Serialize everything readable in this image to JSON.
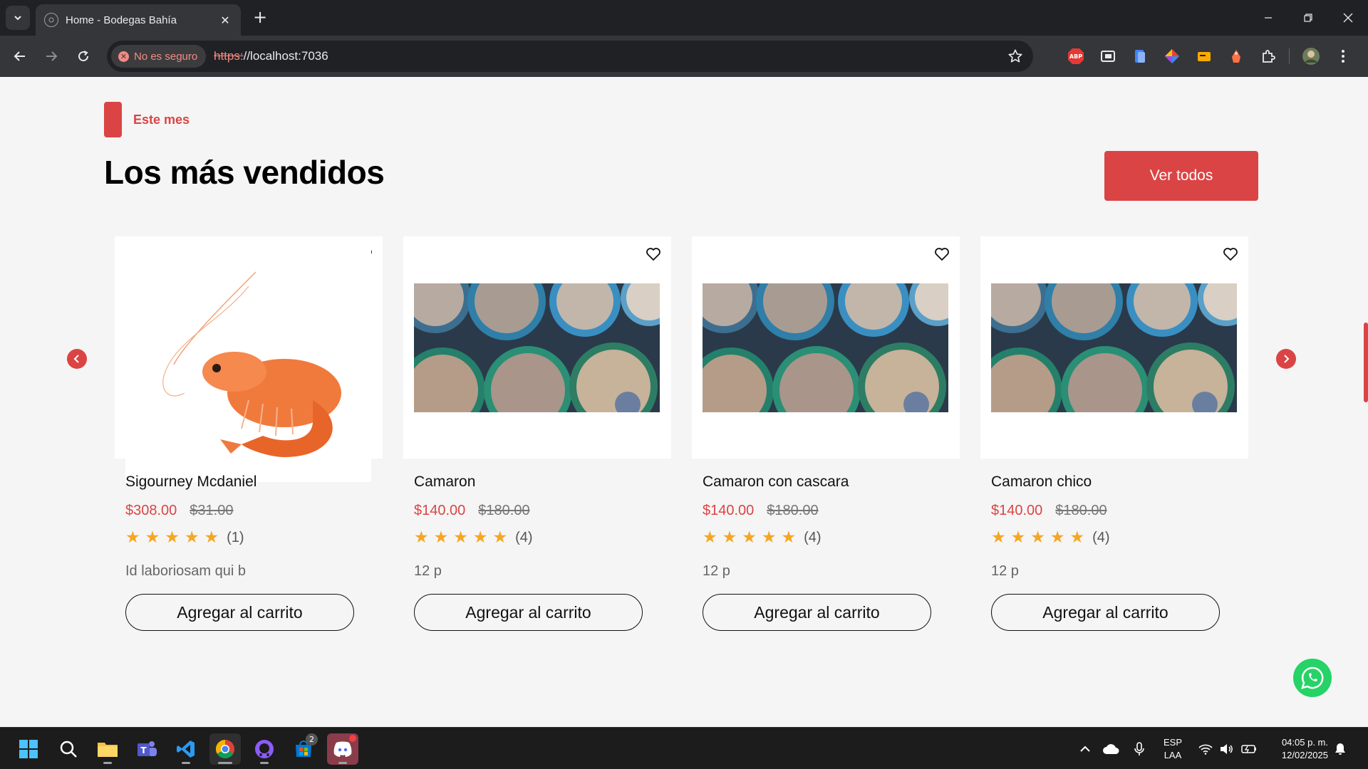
{
  "browser": {
    "tab_title": "Home - Bodegas Bahía",
    "security_label": "No es seguro",
    "url_scheme": "https:",
    "url_rest": "//localhost:7036"
  },
  "section": {
    "tag": "Este mes",
    "title": "Los más vendidos",
    "view_all_label": "Ver todos"
  },
  "products": [
    {
      "name": "Sigourney Mcdaniel",
      "price": "$308.00",
      "old_price": "$31.00",
      "rating": 5,
      "reviews": "(1)",
      "description": "Id laboriosam qui b",
      "button": "Agregar al carrito",
      "image": "shrimp-photo"
    },
    {
      "name": "Camaron",
      "price": "$140.00",
      "old_price": "$180.00",
      "rating": 5,
      "reviews": "(4)",
      "description": "12 p",
      "button": "Agregar al carrito",
      "image": "seafood-tubs-photo"
    },
    {
      "name": "Camaron con cascara",
      "price": "$140.00",
      "old_price": "$180.00",
      "rating": 5,
      "reviews": "(4)",
      "description": "12 p",
      "button": "Agregar al carrito",
      "image": "seafood-tubs-photo"
    },
    {
      "name": "Camaron chico",
      "price": "$140.00",
      "old_price": "$180.00",
      "rating": 5,
      "reviews": "(4)",
      "description": "12 p",
      "button": "Agregar al carrito",
      "image": "seafood-tubs-photo"
    }
  ],
  "taskbar": {
    "language": "ESP",
    "layout": "LAA",
    "time": "04:05 p. m.",
    "date": "12/02/2025",
    "store_badge": "2"
  },
  "colors": {
    "accent": "#db4444",
    "star": "#f5a623",
    "whatsapp": "#25d366"
  }
}
